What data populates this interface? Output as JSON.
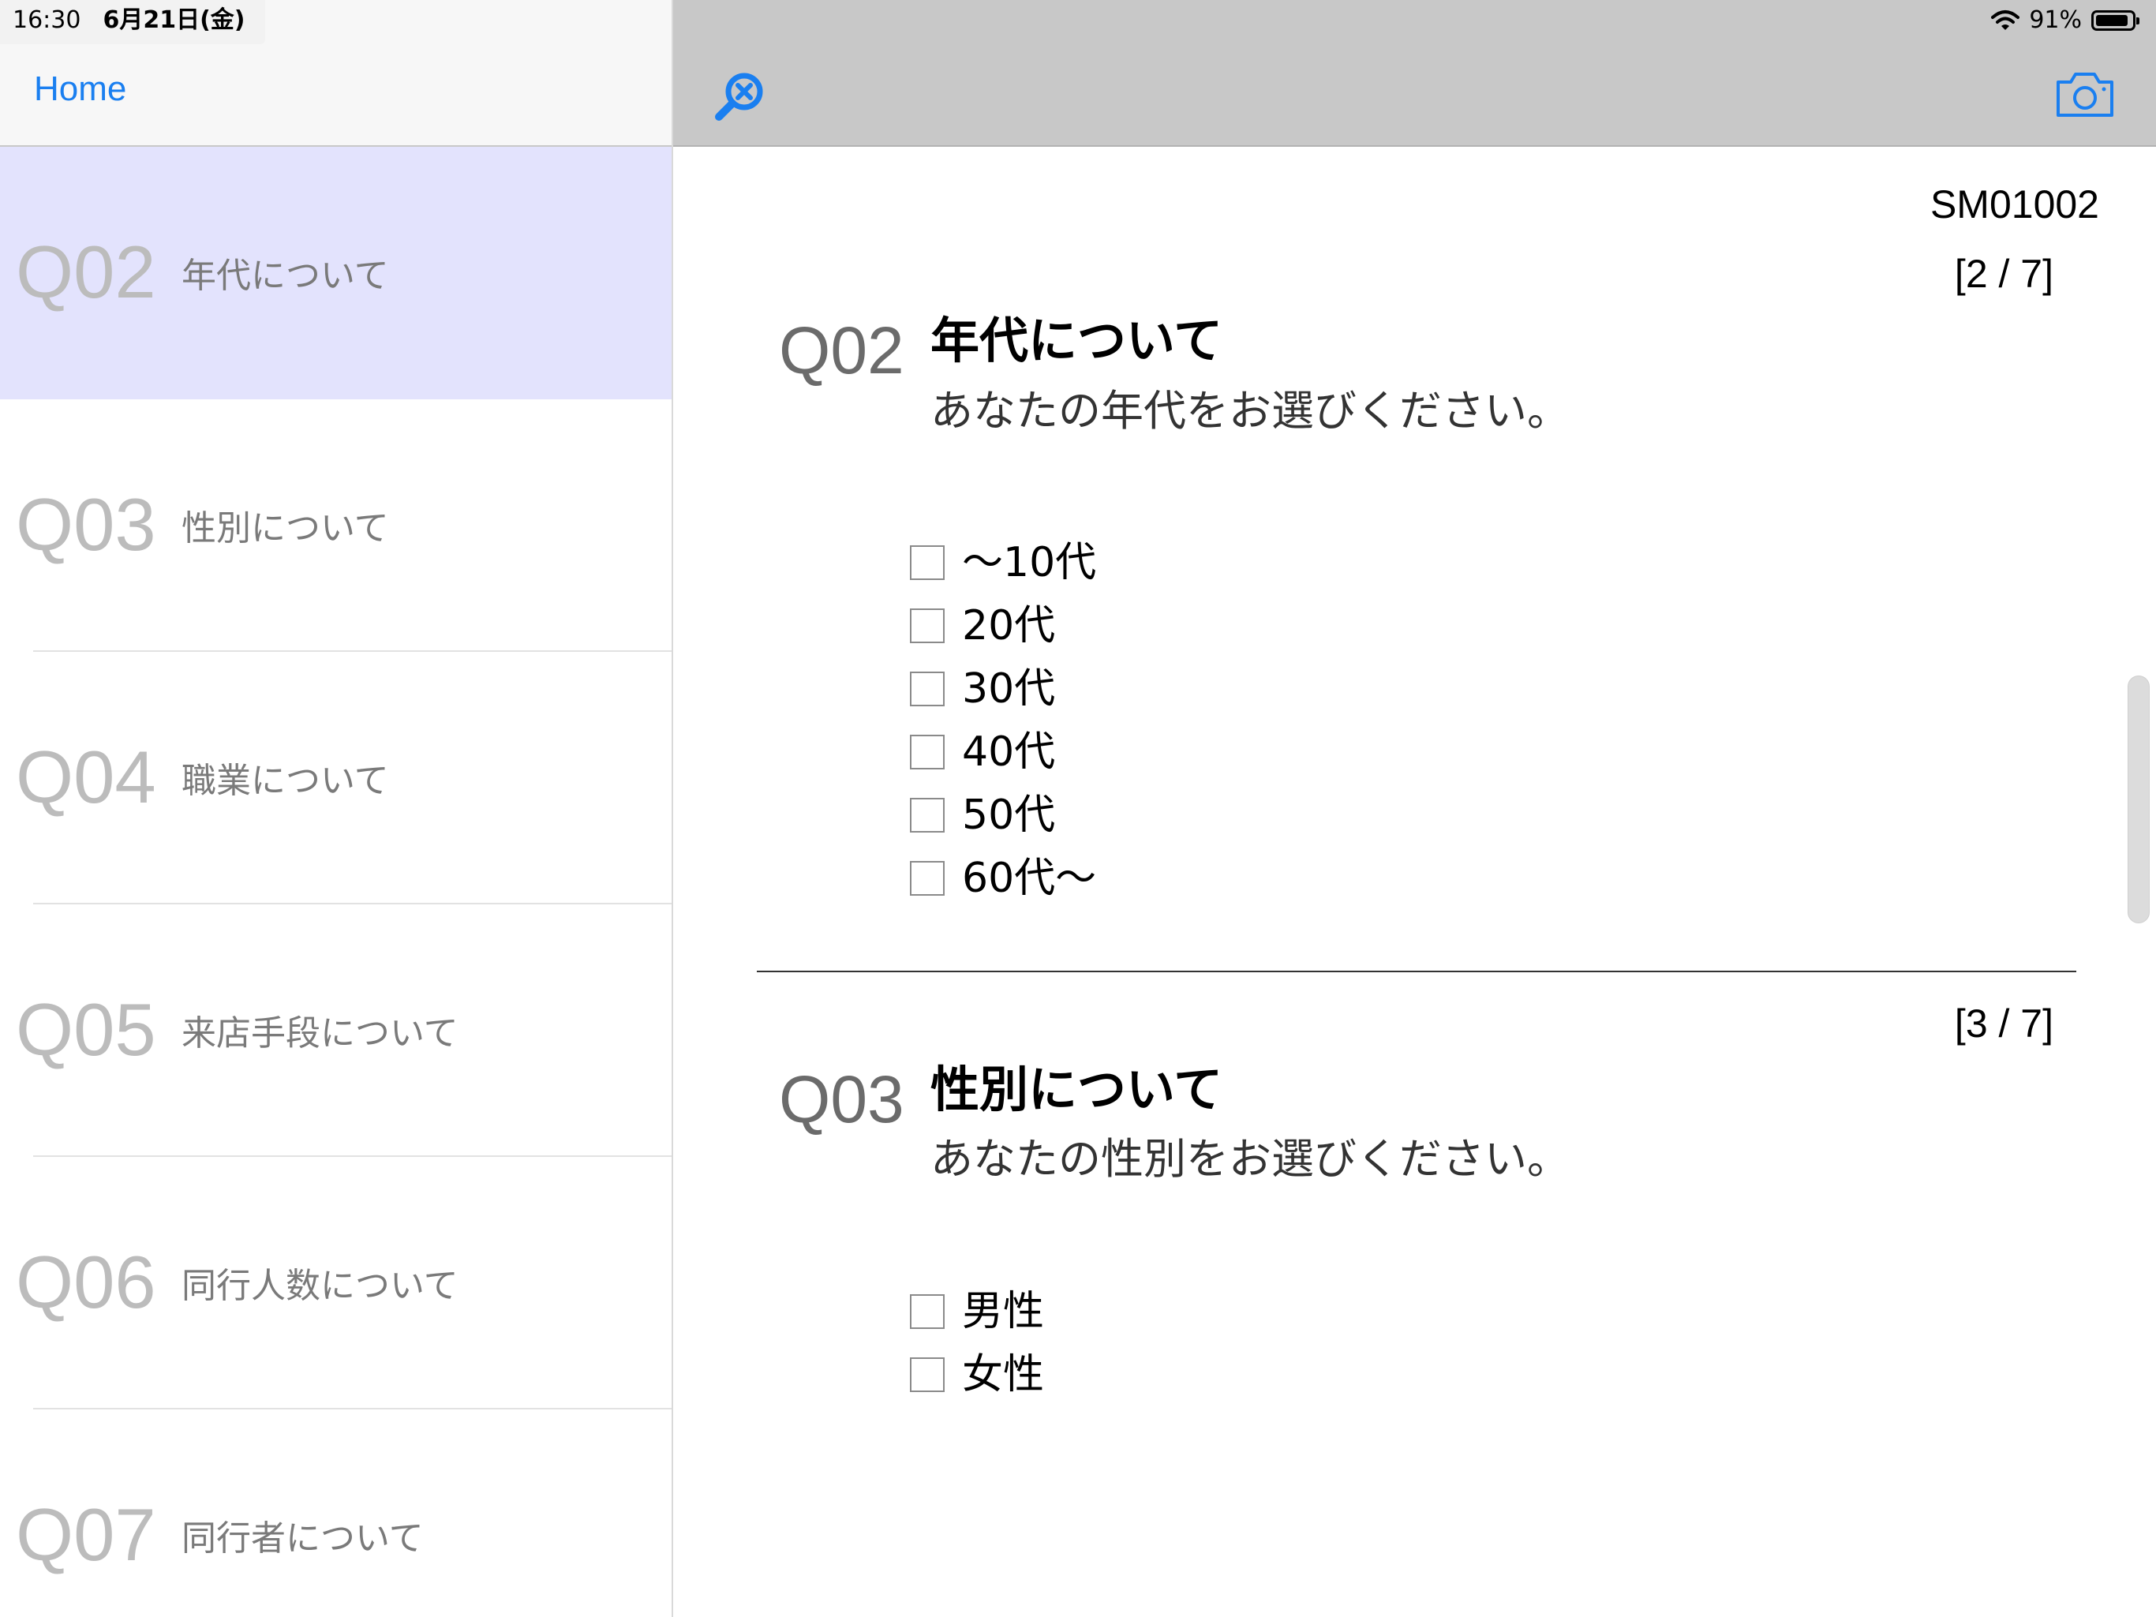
{
  "status_bar": {
    "time": "16:30",
    "date": "6月21日(金)",
    "battery": "91%",
    "battery_level": 0.91
  },
  "sidebar": {
    "home_label": "Home",
    "items": [
      {
        "num": "Q02",
        "label": "年代について"
      },
      {
        "num": "Q03",
        "label": "性別について"
      },
      {
        "num": "Q04",
        "label": "職業について"
      },
      {
        "num": "Q05",
        "label": "来店手段について"
      },
      {
        "num": "Q06",
        "label": "同行人数について"
      },
      {
        "num": "Q07",
        "label": "同行者について"
      }
    ]
  },
  "toolbar": {
    "search_icon": "search-clear-icon",
    "camera_icon": "camera-icon"
  },
  "main": {
    "doc_id": "SM01002",
    "questions": [
      {
        "progress": "[2 / 7]",
        "num": "Q02",
        "title": "年代について",
        "desc": "あなたの年代をお選びください。",
        "options": [
          "～10代",
          "20代",
          "30代",
          "40代",
          "50代",
          "60代～"
        ]
      },
      {
        "progress": "[3 / 7]",
        "num": "Q03",
        "title": "性別について",
        "desc": "あなたの性別をお選びください。",
        "options": [
          "男性",
          "女性"
        ]
      }
    ]
  },
  "colors": {
    "accent": "#1a7ff0",
    "active_row": "#e3e3fd",
    "toolbar_bg": "#c8c8c8"
  }
}
